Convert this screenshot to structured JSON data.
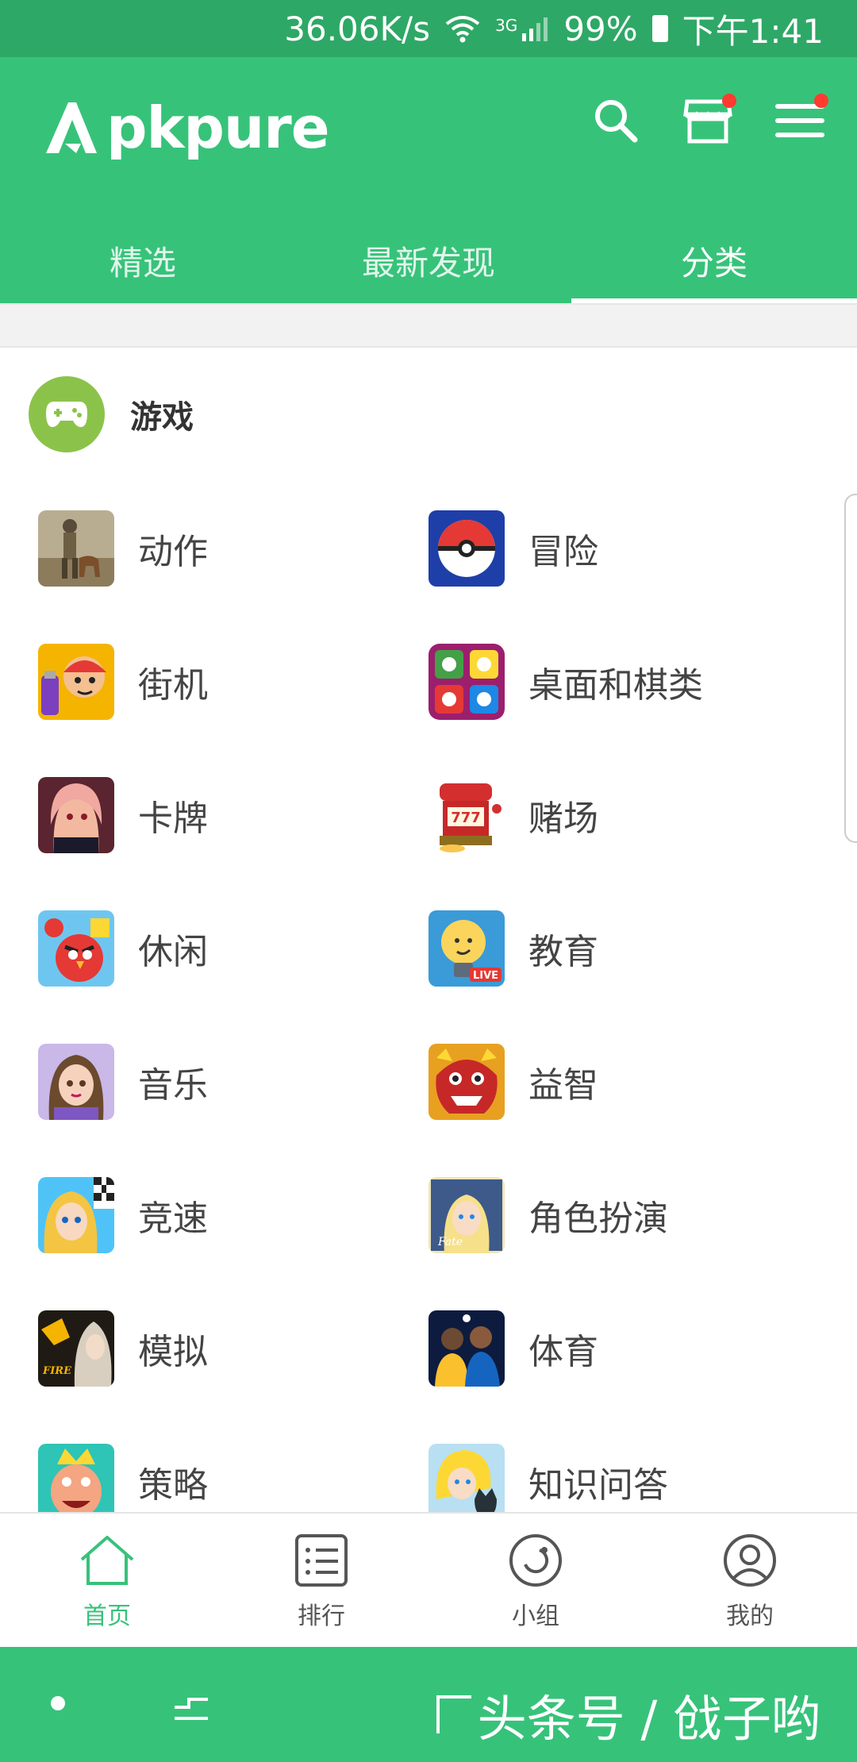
{
  "status_bar": {
    "speed": "36.06K/s",
    "network": "3G",
    "battery": "99%",
    "time": "下午1:41"
  },
  "header": {
    "logo_text": "pkpure"
  },
  "tabs": [
    {
      "label": "精选",
      "active": false
    },
    {
      "label": "最新发现",
      "active": false
    },
    {
      "label": "分类",
      "active": true
    }
  ],
  "section": {
    "title": "游戏",
    "icon": "gamepad-icon",
    "icon_color": "#8bc34a"
  },
  "categories": [
    {
      "label": "动作",
      "icon": "soldier-dog"
    },
    {
      "label": "冒险",
      "icon": "pokeball"
    },
    {
      "label": "街机",
      "icon": "subway-runner"
    },
    {
      "label": "桌面和棋类",
      "icon": "ludo-board"
    },
    {
      "label": "卡牌",
      "icon": "anime-girl"
    },
    {
      "label": "赌场",
      "icon": "slot-machine"
    },
    {
      "label": "休闲",
      "icon": "angry-birds"
    },
    {
      "label": "教育",
      "icon": "lightbulb-live"
    },
    {
      "label": "音乐",
      "icon": "idol-girl"
    },
    {
      "label": "益智",
      "icon": "red-dragon"
    },
    {
      "label": "竞速",
      "icon": "racing-girl"
    },
    {
      "label": "角色扮演",
      "icon": "fate-grand-order"
    },
    {
      "label": "模拟",
      "icon": "fire-emblem-heroes"
    },
    {
      "label": "体育",
      "icon": "football-players"
    },
    {
      "label": "策略",
      "icon": "clash-royale-king"
    },
    {
      "label": "知识问答",
      "icon": "anime-trivia"
    }
  ],
  "bottom_nav": [
    {
      "label": "首页",
      "icon": "home-icon",
      "active": true
    },
    {
      "label": "排行",
      "icon": "ranking-list-icon",
      "active": false
    },
    {
      "label": "小组",
      "icon": "group-ring-icon",
      "active": false
    },
    {
      "label": "我的",
      "icon": "profile-icon",
      "active": false
    }
  ],
  "watermark": "头条号 / 戗子哟",
  "colors": {
    "brand": "#37c27a",
    "status_bar": "#2ea866",
    "badge": "#ff3b2f",
    "active_nav": "#37c27a"
  }
}
